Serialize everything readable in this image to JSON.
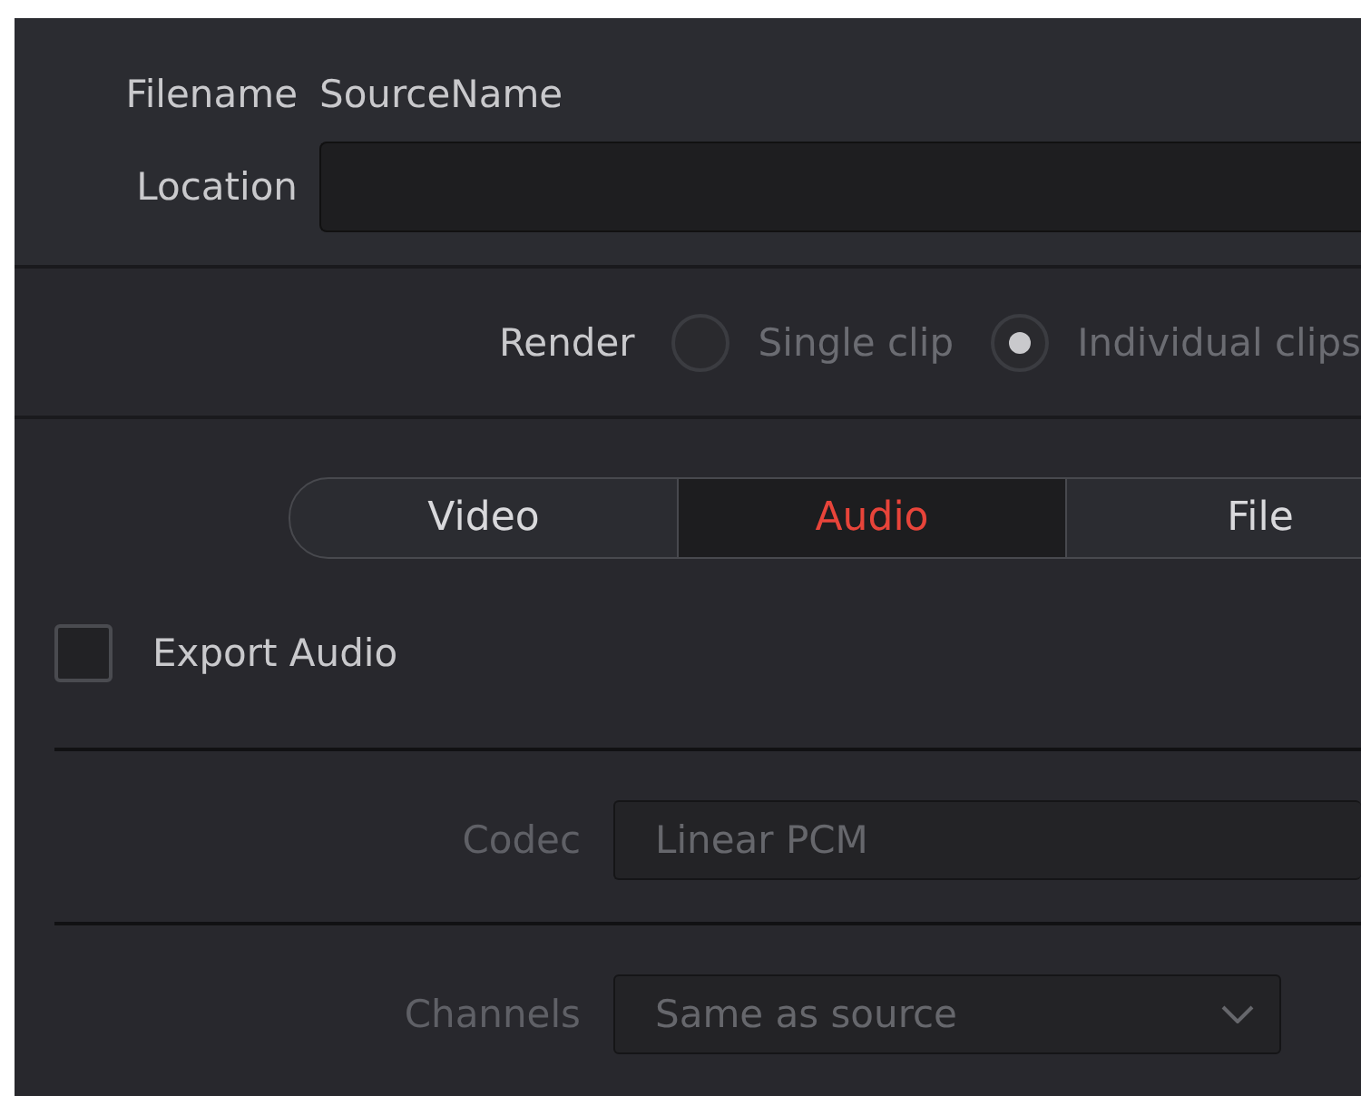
{
  "filename": {
    "label": "Filename",
    "value": "SourceName"
  },
  "location": {
    "label": "Location"
  },
  "render": {
    "label": "Render",
    "options": [
      {
        "label": "Single clip",
        "selected": false
      },
      {
        "label": "Individual clips",
        "selected": true
      }
    ]
  },
  "tabs": [
    {
      "label": "Video",
      "selected": false
    },
    {
      "label": "Audio",
      "selected": true
    },
    {
      "label": "File",
      "selected": false
    }
  ],
  "export_audio": {
    "label": "Export Audio",
    "checked": false
  },
  "settings": [
    {
      "kind": "field",
      "label": "Codec",
      "value": "Linear PCM",
      "disabled": true
    },
    {
      "kind": "dropdown",
      "label": "Channels",
      "value": "Same as source",
      "disabled": true
    }
  ]
}
